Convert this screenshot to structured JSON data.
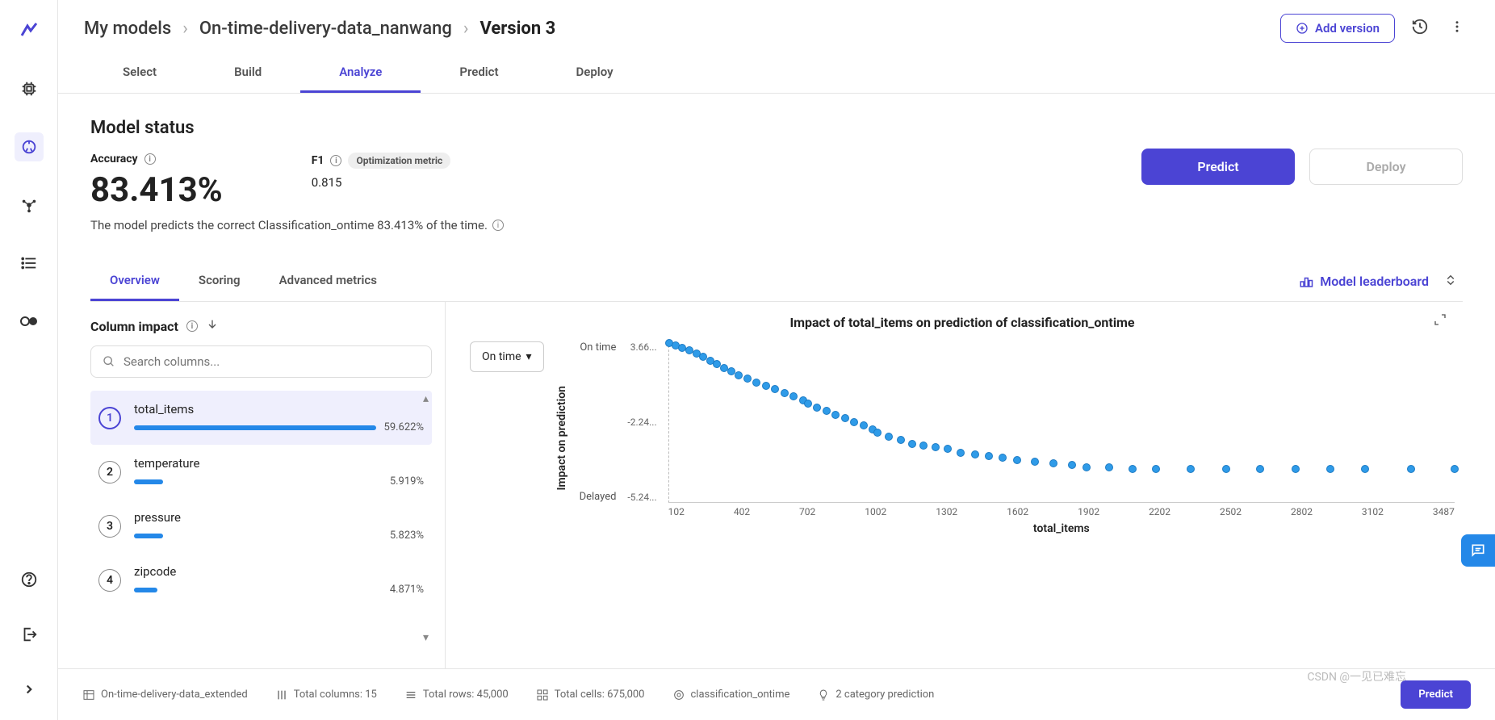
{
  "breadcrumb": {
    "root": "My models",
    "project": "On-time-delivery-data_nanwang",
    "version": "Version 3"
  },
  "header": {
    "add_version": "Add version"
  },
  "tabs": {
    "select": "Select",
    "build": "Build",
    "analyze": "Analyze",
    "predict": "Predict",
    "deploy": "Deploy"
  },
  "status": {
    "title": "Model status",
    "accuracy_label": "Accuracy",
    "accuracy_value": "83.413%",
    "f1_label": "F1",
    "f1_value": "0.815",
    "opt_metric": "Optimization metric",
    "desc": "The model predicts the correct Classification_ontime 83.413% of the time.",
    "predict_btn": "Predict",
    "deploy_btn": "Deploy"
  },
  "subtabs": {
    "overview": "Overview",
    "scoring": "Scoring",
    "advanced": "Advanced metrics",
    "leaderboard": "Model leaderboard"
  },
  "column_impact": {
    "title": "Column impact",
    "search_placeholder": "Search columns...",
    "items": [
      {
        "rank": "1",
        "name": "total_items",
        "value": "59.622%",
        "bar": 100
      },
      {
        "rank": "2",
        "name": "temperature",
        "value": "5.919%",
        "bar": 10
      },
      {
        "rank": "3",
        "name": "pressure",
        "value": "5.823%",
        "bar": 10
      },
      {
        "rank": "4",
        "name": "zipcode",
        "value": "4.871%",
        "bar": 8
      }
    ]
  },
  "chart_data": {
    "type": "scatter",
    "title": "Impact of total_items on prediction of classification_ontime",
    "class_selector": "On time",
    "xlabel": "total_items",
    "ylabel": "Impact on prediction",
    "y_category_top": "On time",
    "y_category_bottom": "Delayed",
    "yticks": [
      "3.66...",
      "-2.24...",
      "-5.24..."
    ],
    "xticks": [
      "102",
      "402",
      "702",
      "1002",
      "1302",
      "1602",
      "1902",
      "2202",
      "2502",
      "2802",
      "3102",
      "3487"
    ],
    "xlim": [
      102,
      3487
    ],
    "ylim": [
      -5.24,
      3.66
    ],
    "series": [
      {
        "name": "impact",
        "x": [
          102,
          130,
          160,
          190,
          220,
          250,
          280,
          310,
          340,
          370,
          402,
          440,
          480,
          520,
          560,
          600,
          640,
          680,
          702,
          740,
          780,
          820,
          860,
          900,
          940,
          980,
          1002,
          1050,
          1100,
          1150,
          1200,
          1250,
          1302,
          1360,
          1420,
          1480,
          1540,
          1602,
          1680,
          1760,
          1840,
          1902,
          2000,
          2100,
          2202,
          2350,
          2502,
          2650,
          2802,
          2950,
          3102,
          3300,
          3487
        ],
        "y": [
          3.55,
          3.45,
          3.3,
          3.15,
          3.0,
          2.8,
          2.6,
          2.4,
          2.2,
          2.0,
          1.8,
          1.6,
          1.4,
          1.2,
          1.0,
          0.8,
          0.6,
          0.4,
          0.2,
          0.0,
          -0.2,
          -0.4,
          -0.6,
          -0.8,
          -1.0,
          -1.2,
          -1.4,
          -1.6,
          -1.8,
          -2.0,
          -2.1,
          -2.2,
          -2.3,
          -2.5,
          -2.6,
          -2.7,
          -2.8,
          -2.9,
          -3.0,
          -3.1,
          -3.2,
          -3.3,
          -3.3,
          -3.4,
          -3.4,
          -3.4,
          -3.4,
          -3.4,
          -3.4,
          -3.4,
          -3.4,
          -3.4,
          -3.4
        ]
      }
    ]
  },
  "footer": {
    "dataset": "On-time-delivery-data_extended",
    "cols": "Total columns: 15",
    "rows": "Total rows: 45,000",
    "cells": "Total cells: 675,000",
    "target": "classification_ontime",
    "pred_type": "2 category prediction",
    "predict_btn": "Predict"
  },
  "watermark": "CSDN @一见已难忘"
}
